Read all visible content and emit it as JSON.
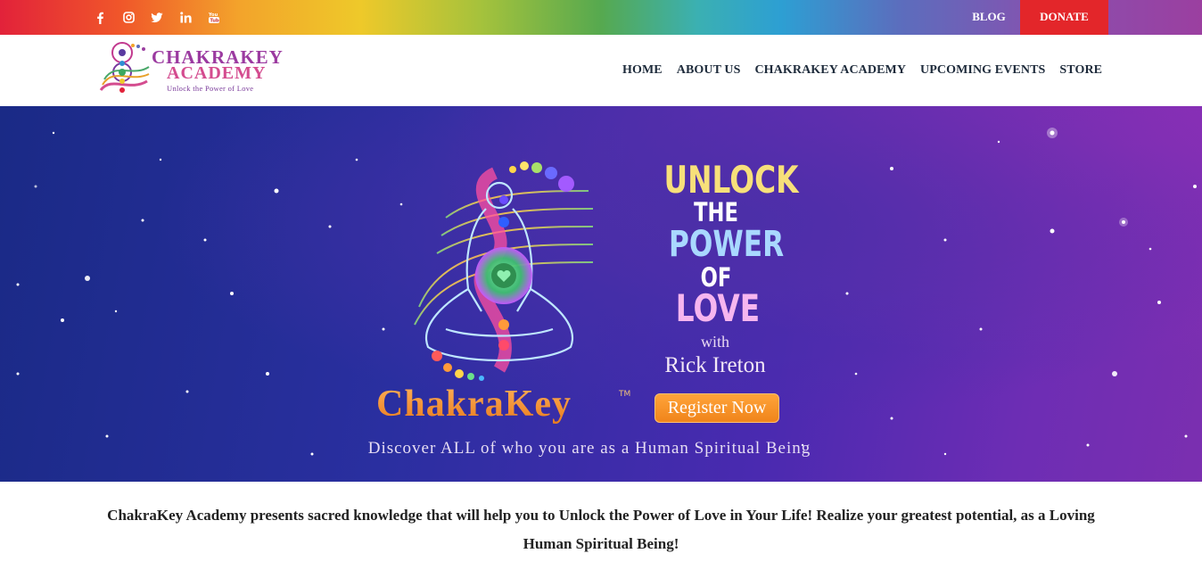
{
  "topbar": {
    "social": [
      {
        "icon": "facebook-icon",
        "glyph": "f"
      },
      {
        "icon": "instagram-icon",
        "glyph": "ig"
      },
      {
        "icon": "twitter-icon",
        "glyph": "tw"
      },
      {
        "icon": "linkedin-icon",
        "glyph": "in"
      },
      {
        "icon": "youtube-icon",
        "glyph": "yt"
      }
    ],
    "blog_label": "BLOG",
    "donate_label": "DONATE",
    "donate_color": "#e3262a"
  },
  "header": {
    "logo": {
      "line1": "CHAKRAKEY",
      "line2": "ACADEMY",
      "tagline": "Unlock the Power of Love"
    },
    "nav": [
      "HOME",
      "ABOUT US",
      "CHAKRAKEY ACADEMY",
      "UPCOMING EVENTS",
      "STORE"
    ]
  },
  "hero": {
    "title_lines": [
      "UNLOCK",
      "THE",
      "POWER",
      "OF",
      "LOVE"
    ],
    "with": "with",
    "presenter": "Rick Ireton",
    "register_label": "Register Now",
    "brand": "ChakraKey",
    "tm": "TM",
    "tagline": "Discover ALL of who you are as a Human Spiritual Being"
  },
  "intro": {
    "text": "ChakraKey Academy presents sacred knowledge that will help you to Unlock the Power of Love in Your Life! Realize your greatest potential, as a Loving Human Spiritual Being!"
  }
}
